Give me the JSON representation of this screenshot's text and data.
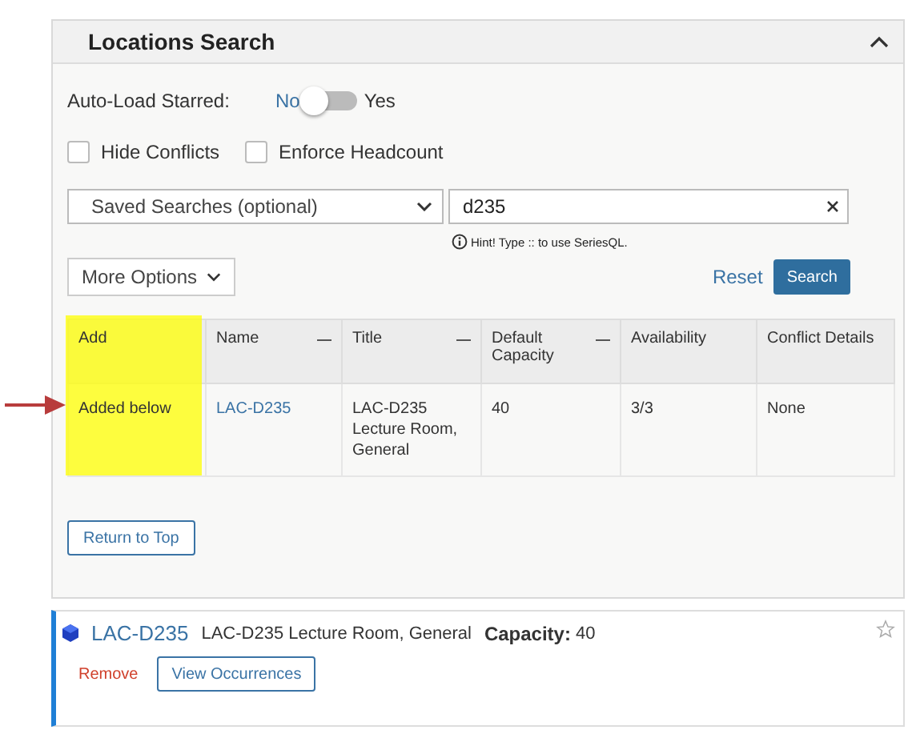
{
  "panel": {
    "title": "Locations Search",
    "expanded": true
  },
  "auto_load": {
    "label": "Auto-Load Starred:",
    "off_label": "No",
    "on_label": "Yes",
    "on": false
  },
  "checkboxes": [
    {
      "label": "Hide Conflicts",
      "checked": false
    },
    {
      "label": "Enforce Headcount",
      "checked": false
    }
  ],
  "saved_searches": {
    "placeholder": "Saved Searches (optional)"
  },
  "search": {
    "value": "d235",
    "hint": "Hint! Type :: to use SeriesQL."
  },
  "more_options": "More Options",
  "reset": "Reset",
  "search_button": "Search",
  "table": {
    "columns": [
      {
        "label": "Add",
        "menu": false,
        "highlighted": true
      },
      {
        "label": "Name",
        "menu": true,
        "highlighted": false
      },
      {
        "label": "Title",
        "menu": true,
        "highlighted": false
      },
      {
        "label": "Default Capacity",
        "menu": true,
        "highlighted": false
      },
      {
        "label": "Availability",
        "menu": false,
        "highlighted": false
      },
      {
        "label": "Conflict Details",
        "menu": false,
        "highlighted": false
      }
    ],
    "rows": [
      {
        "cells": [
          {
            "kind": "text",
            "text": "Added below"
          },
          {
            "kind": "link",
            "text": "LAC-D235"
          },
          {
            "kind": "text",
            "text": "LAC-D235 Lecture Room, General"
          },
          {
            "kind": "text",
            "text": "40"
          },
          {
            "kind": "text",
            "text": "3/3"
          },
          {
            "kind": "text",
            "text": "None"
          }
        ]
      }
    ]
  },
  "return_to_top": "Return to Top",
  "selected_location": {
    "name": "LAC-D235",
    "title": "LAC-D235 Lecture Room, General",
    "capacity_label": "Capacity:",
    "capacity": "40",
    "starred": false,
    "remove": "Remove",
    "view": "View Occurrences"
  }
}
